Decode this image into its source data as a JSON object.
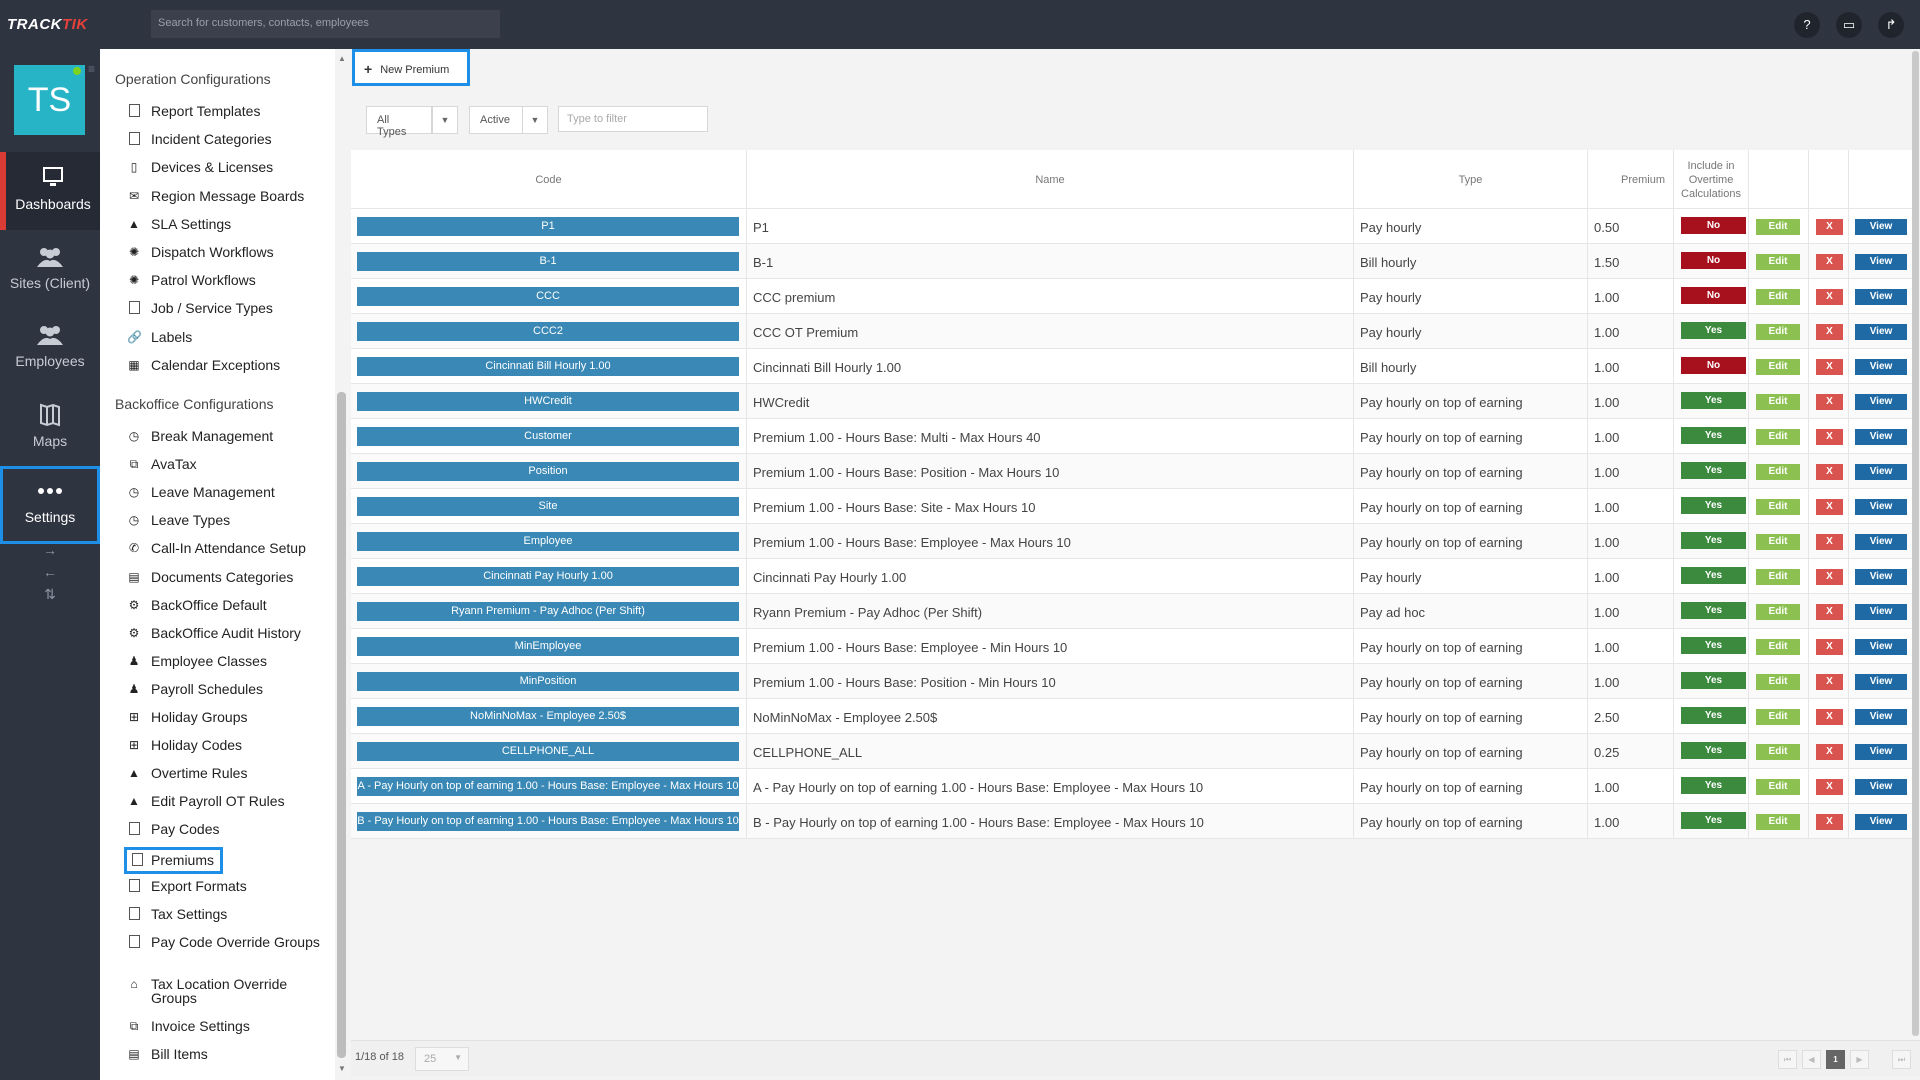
{
  "app": {
    "logo_a": "TRACK",
    "logo_b": "TIK"
  },
  "search": {
    "placeholder": "Search for customers, contacts, employees"
  },
  "top_icons": {
    "help": "?",
    "monitor": "▭",
    "share": "↱"
  },
  "user": {
    "initials": "TS"
  },
  "nav": [
    {
      "label": "Dashboards",
      "icon": "monitor-icon"
    },
    {
      "label": "Sites (Client)",
      "icon": "people-icon"
    },
    {
      "label": "Employees",
      "icon": "people-icon"
    },
    {
      "label": "Maps",
      "icon": "map-icon"
    },
    {
      "label": "Settings",
      "icon": "dots-icon"
    }
  ],
  "nav_arrows": [
    "→",
    "←",
    "⇅"
  ],
  "menu": {
    "operation_title": "Operation Configurations",
    "operation_items": [
      {
        "label": "Report Templates",
        "icon": "document-icon"
      },
      {
        "label": "Incident Categories",
        "icon": "document-icon"
      },
      {
        "label": "Devices & Licenses",
        "icon": "phone-icon"
      },
      {
        "label": "Region Message Boards",
        "icon": "envelope-icon"
      },
      {
        "label": "SLA Settings",
        "icon": "warning-icon"
      },
      {
        "label": "Dispatch Workflows",
        "icon": "workflow-icon"
      },
      {
        "label": "Patrol Workflows",
        "icon": "workflow-icon"
      },
      {
        "label": "Job / Service Types",
        "icon": "document-icon"
      },
      {
        "label": "Labels",
        "icon": "link-icon"
      },
      {
        "label": "Calendar Exceptions",
        "icon": "calendar-icon"
      }
    ],
    "backoffice_title": "Backoffice Configurations",
    "backoffice_items": [
      {
        "label": "Break Management",
        "icon": "clock-icon"
      },
      {
        "label": "AvaTax",
        "icon": "copy-icon"
      },
      {
        "label": "Leave Management",
        "icon": "clock-icon"
      },
      {
        "label": "Leave Types",
        "icon": "clock-icon"
      },
      {
        "label": "Call-In Attendance Setup",
        "icon": "phone-handset-icon"
      },
      {
        "label": "Documents Categories",
        "icon": "list-icon"
      },
      {
        "label": "BackOffice Default",
        "icon": "gear-icon"
      },
      {
        "label": "BackOffice Audit History",
        "icon": "gear-icon"
      },
      {
        "label": "Employee Classes",
        "icon": "person-icon"
      },
      {
        "label": "Payroll Schedules",
        "icon": "person-icon"
      },
      {
        "label": "Holiday Groups",
        "icon": "gift-icon"
      },
      {
        "label": "Holiday Codes",
        "icon": "gift-icon"
      },
      {
        "label": "Overtime Rules",
        "icon": "warning-icon"
      },
      {
        "label": "Edit Payroll OT Rules",
        "icon": "warning-icon"
      },
      {
        "label": "Pay Codes",
        "icon": "document-icon"
      },
      {
        "label": "Premiums",
        "icon": "document-icon"
      },
      {
        "label": "Export Formats",
        "icon": "document-icon"
      },
      {
        "label": "Tax Settings",
        "icon": "document-icon"
      },
      {
        "label": "Pay Code Override Groups",
        "icon": "document-icon"
      },
      {
        "label": "Tax Location Override Groups",
        "icon": "home-icon"
      },
      {
        "label": "Invoice Settings",
        "icon": "copy-icon"
      },
      {
        "label": "Bill Items",
        "icon": "list-icon"
      }
    ]
  },
  "toolbar": {
    "new_premium": "New Premium"
  },
  "filters": {
    "types": "All Types",
    "status": "Active",
    "filter_placeholder": "Type to filter"
  },
  "table": {
    "headers": {
      "code": "Code",
      "name": "Name",
      "type": "Type",
      "premium": "Premium",
      "overtime": "Include in Overtime Calculations"
    },
    "action_labels": {
      "edit": "Edit",
      "delete": "X",
      "view": "View"
    },
    "rows": [
      {
        "code": "P1",
        "name": "P1",
        "type": "Pay hourly",
        "premium": "0.50",
        "overtime": "No"
      },
      {
        "code": "B-1",
        "name": "B-1",
        "type": "Bill hourly",
        "premium": "1.50",
        "overtime": "No"
      },
      {
        "code": "CCC",
        "name": "CCC premium",
        "type": "Pay hourly",
        "premium": "1.00",
        "overtime": "No"
      },
      {
        "code": "CCC2",
        "name": "CCC OT Premium",
        "type": "Pay hourly",
        "premium": "1.00",
        "overtime": "Yes"
      },
      {
        "code": "Cincinnati Bill Hourly 1.00",
        "name": "Cincinnati Bill Hourly 1.00",
        "type": "Bill hourly",
        "premium": "1.00",
        "overtime": "No"
      },
      {
        "code": "HWCredit",
        "name": "HWCredit",
        "type": "Pay hourly on top of earning",
        "premium": "1.00",
        "overtime": "Yes"
      },
      {
        "code": "Customer",
        "name": "Premium 1.00 - Hours Base: Multi - Max Hours 40",
        "type": "Pay hourly on top of earning",
        "premium": "1.00",
        "overtime": "Yes"
      },
      {
        "code": "Position",
        "name": "Premium 1.00 - Hours Base: Position - Max Hours 10",
        "type": "Pay hourly on top of earning",
        "premium": "1.00",
        "overtime": "Yes"
      },
      {
        "code": "Site",
        "name": "Premium 1.00 - Hours Base: Site - Max Hours 10",
        "type": "Pay hourly on top of earning",
        "premium": "1.00",
        "overtime": "Yes"
      },
      {
        "code": "Employee",
        "name": "Premium 1.00 - Hours Base: Employee - Max Hours 10",
        "type": "Pay hourly on top of earning",
        "premium": "1.00",
        "overtime": "Yes"
      },
      {
        "code": "Cincinnati Pay Hourly 1.00",
        "name": "Cincinnati Pay Hourly 1.00",
        "type": "Pay hourly",
        "premium": "1.00",
        "overtime": "Yes"
      },
      {
        "code": "Ryann Premium - Pay Adhoc (Per Shift)",
        "name": "Ryann Premium - Pay Adhoc (Per Shift)",
        "type": "Pay ad hoc",
        "premium": "1.00",
        "overtime": "Yes"
      },
      {
        "code": "MinEmployee",
        "name": "Premium 1.00 - Hours Base: Employee - Min Hours 10",
        "type": "Pay hourly on top of earning",
        "premium": "1.00",
        "overtime": "Yes"
      },
      {
        "code": "MinPosition",
        "name": "Premium 1.00 - Hours Base: Position - Min Hours 10",
        "type": "Pay hourly on top of earning",
        "premium": "1.00",
        "overtime": "Yes"
      },
      {
        "code": "NoMinNoMax - Employee 2.50$",
        "name": "NoMinNoMax - Employee 2.50$",
        "type": "Pay hourly on top of earning",
        "premium": "2.50",
        "overtime": "Yes"
      },
      {
        "code": "CELLPHONE_ALL",
        "name": "CELLPHONE_ALL",
        "type": "Pay hourly on top of earning",
        "premium": "0.25",
        "overtime": "Yes"
      },
      {
        "code": "A - Pay Hourly on top of earning 1.00 - Hours Base: Employee - Max Hours 10",
        "name": "A - Pay Hourly on top of earning 1.00 - Hours Base: Employee - Max Hours 10",
        "type": "Pay hourly on top of earning",
        "premium": "1.00",
        "overtime": "Yes"
      },
      {
        "code": "B - Pay Hourly on top of earning 1.00 - Hours Base: Employee - Max Hours 10",
        "name": "B - Pay Hourly on top of earning 1.00 - Hours Base: Employee - Max Hours 10",
        "type": "Pay hourly on top of earning",
        "premium": "1.00",
        "overtime": "Yes"
      }
    ]
  },
  "footer": {
    "count": "1/18 of 18",
    "page_size": "25",
    "current_page": "1"
  },
  "colors": {
    "accent": "#1e8fe6",
    "nav_bg": "#2f3441",
    "code_pill": "#3a88b5",
    "no": "#a6111d",
    "yes": "#3b8a3e",
    "edit": "#8cc152",
    "delete": "#d9534f",
    "view": "#1f6aa5",
    "avatar": "#26b4c6"
  }
}
